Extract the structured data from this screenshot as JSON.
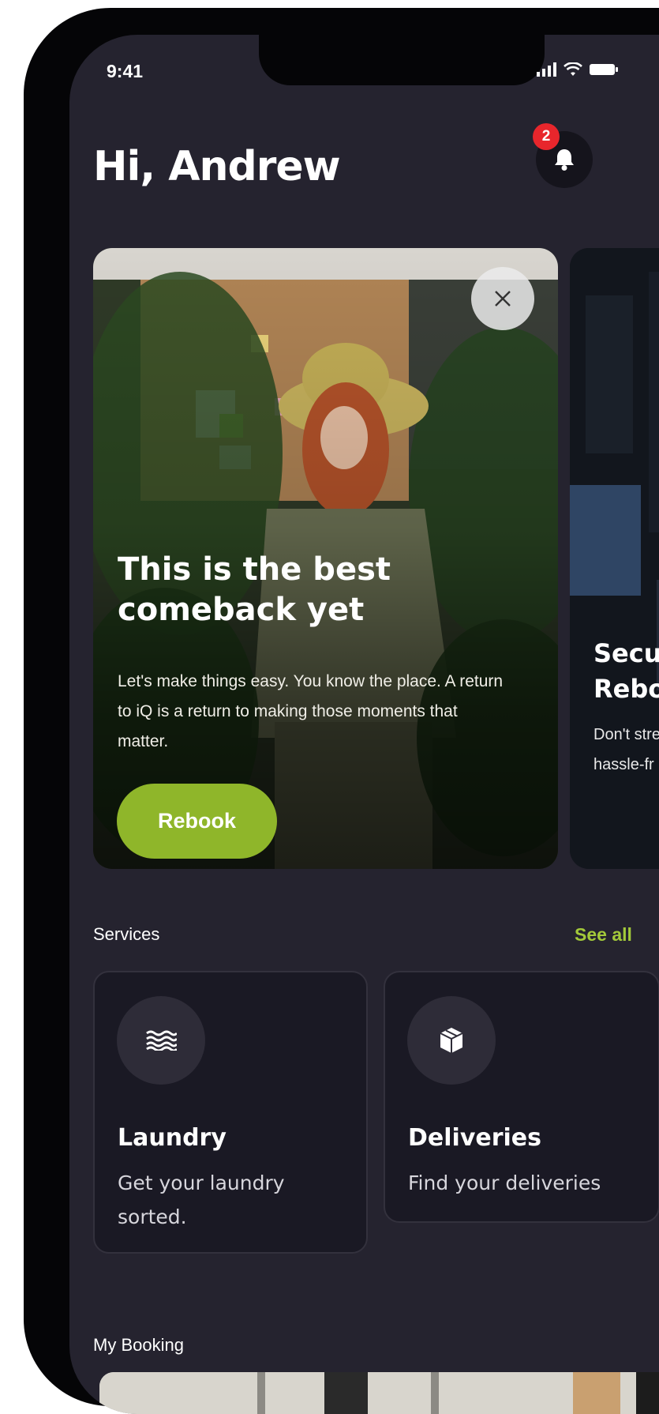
{
  "status_bar": {
    "time": "9:41"
  },
  "header": {
    "greeting": "Hi, Andrew",
    "notification_count": "2"
  },
  "promo_cards": [
    {
      "title": "This is the best comeback yet",
      "body": "Let's make things easy. You know the place. A return to iQ is a return to making those moments that matter.",
      "button_label": "Rebook"
    },
    {
      "title_line1": "Secur",
      "title_line2": "Reboc",
      "body_line1": "Don't stre",
      "body_line2": "hassle-fr"
    }
  ],
  "services": {
    "label": "Services",
    "see_all": "See all",
    "items": [
      {
        "title": "Laundry",
        "description": "Get your laundry sorted.",
        "icon": "waves-icon"
      },
      {
        "title": "Deliveries",
        "description": "Find your deliveries",
        "icon": "package-icon"
      }
    ]
  },
  "my_booking": {
    "label": "My Booking"
  },
  "colors": {
    "background": "#25232f",
    "accent_green": "#8fb62a",
    "see_all_green": "#a3c93a",
    "badge_red": "#e8262c",
    "card_surface": "#1a1924"
  }
}
